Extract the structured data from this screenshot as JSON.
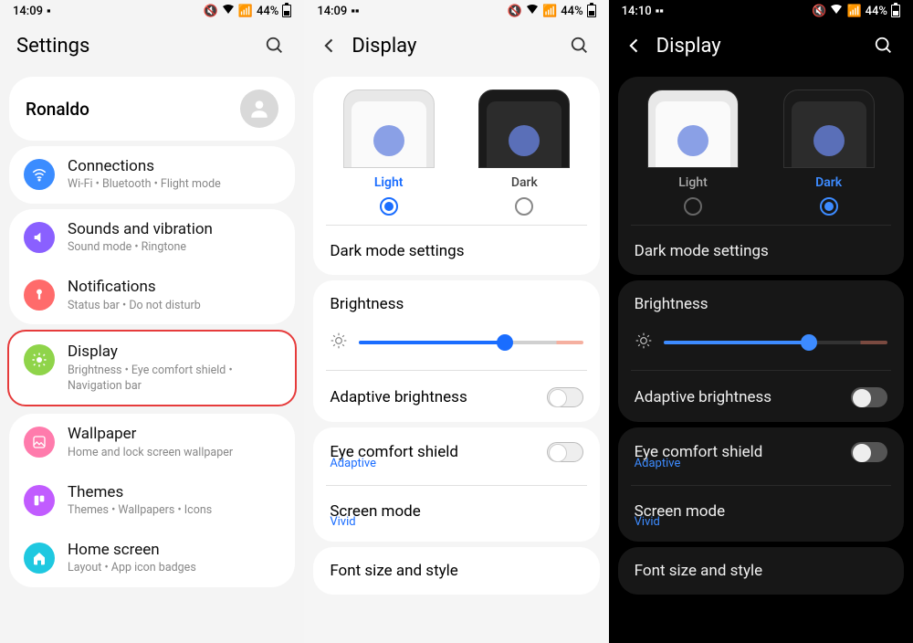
{
  "status": {
    "t1": "14:09",
    "t2": "14:09",
    "t3": "14:10",
    "battery": "44%"
  },
  "p1": {
    "title": "Settings",
    "profile": "Ronaldo",
    "items": [
      {
        "title": "Connections",
        "sub": "Wi-Fi  •  Bluetooth  •  Flight mode"
      },
      {
        "title": "Sounds and vibration",
        "sub": "Sound mode  •  Ringtone"
      },
      {
        "title": "Notifications",
        "sub": "Status bar  •  Do not disturb"
      },
      {
        "title": "Display",
        "sub": "Brightness  •  Eye comfort shield  •  Navigation bar"
      },
      {
        "title": "Wallpaper",
        "sub": "Home and lock screen wallpaper"
      },
      {
        "title": "Themes",
        "sub": "Themes  •  Wallpapers  •  Icons"
      },
      {
        "title": "Home screen",
        "sub": "Layout  •  App icon badges"
      }
    ]
  },
  "disp": {
    "title": "Display",
    "light": "Light",
    "dark": "Dark",
    "dark_mode": "Dark mode settings",
    "brightness": "Brightness",
    "adaptive_brightness": "Adaptive brightness",
    "eye": "Eye comfort shield",
    "eye_sub": "Adaptive",
    "screen_mode": "Screen mode",
    "screen_mode_sub": "Vivid",
    "font": "Font size and style"
  }
}
